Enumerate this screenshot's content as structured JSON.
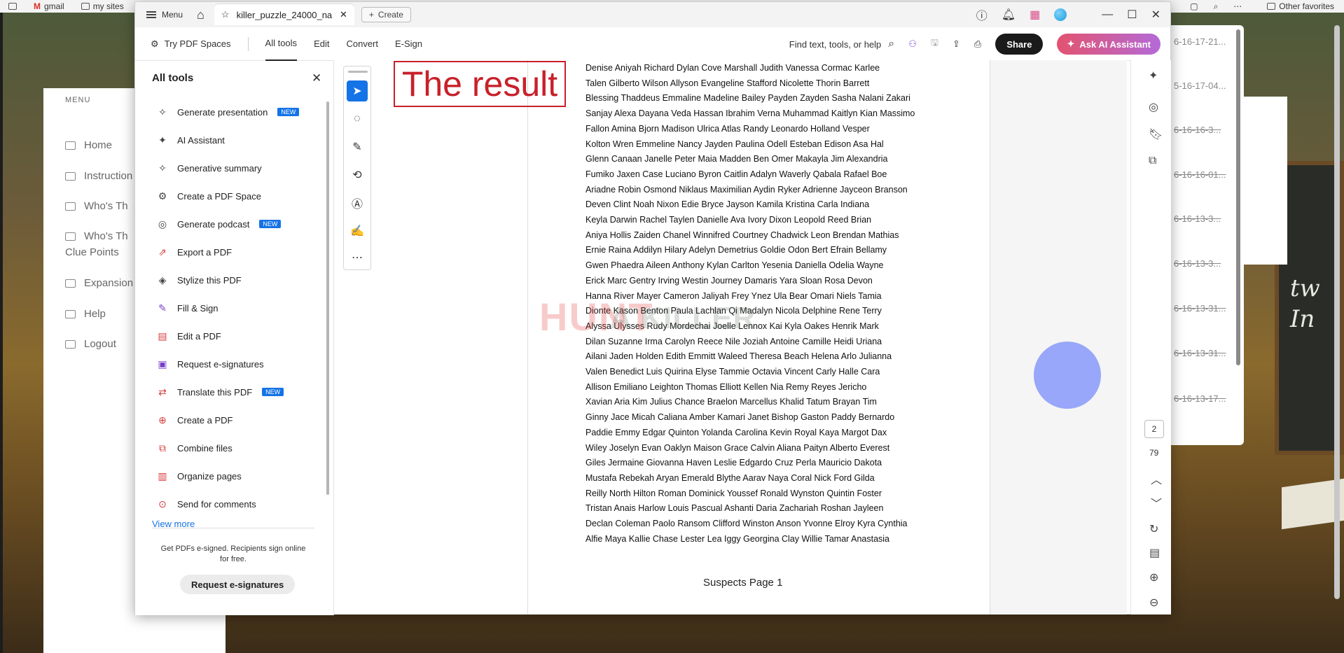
{
  "browser": {
    "bookmarks": [
      "gmail",
      "my sites"
    ],
    "other_favorites": "Other favorites"
  },
  "site": {
    "menu_title": "MENU",
    "nav": [
      "Home",
      "Instruction",
      "Who's Th",
      "Who's Th",
      "Clue Points",
      "Expansion",
      "Help",
      "Logout"
    ]
  },
  "side_window": {
    "entries": [
      "6-16-17-21...",
      "5-16-17-04...",
      "6-16-16-3...",
      "6-16-16-01...",
      "6-16-13-3...",
      "6-16-13-3...",
      "6-16-13-31...",
      "6-16-13-31...",
      "6-16-13-17..."
    ]
  },
  "blackboard": {
    "text": "tw\nIn"
  },
  "app": {
    "menu_label": "Menu",
    "tab_title": "killer_puzzle_24000_na...",
    "create_label": "Create",
    "toolbar": {
      "try_spaces": "Try PDF Spaces",
      "tabs": [
        "All tools",
        "Edit",
        "Convert",
        "E-Sign"
      ],
      "find": "Find text, tools, or help",
      "share": "Share",
      "ai": "Ask AI Assistant"
    },
    "tools_panel": {
      "title": "All tools",
      "items": [
        {
          "label": "Generate presentation",
          "badge": "NEW",
          "icon": "sparkle-icon"
        },
        {
          "label": "AI Assistant",
          "badge": "",
          "icon": "ai-chat-icon"
        },
        {
          "label": "Generative summary",
          "badge": "",
          "icon": "summary-icon"
        },
        {
          "label": "Create a PDF Space",
          "badge": "",
          "icon": "space-icon"
        },
        {
          "label": "Generate podcast",
          "badge": "NEW",
          "icon": "podcast-icon"
        },
        {
          "label": "Export a PDF",
          "badge": "",
          "icon": "export-icon"
        },
        {
          "label": "Stylize this PDF",
          "badge": "",
          "icon": "stylize-icon"
        },
        {
          "label": "Fill & Sign",
          "badge": "",
          "icon": "sign-icon"
        },
        {
          "label": "Edit a PDF",
          "badge": "",
          "icon": "edit-icon"
        },
        {
          "label": "Request e-signatures",
          "badge": "",
          "icon": "request-sign-icon"
        },
        {
          "label": "Translate this PDF",
          "badge": "NEW",
          "icon": "translate-icon"
        },
        {
          "label": "Create a PDF",
          "badge": "",
          "icon": "create-pdf-icon"
        },
        {
          "label": "Combine files",
          "badge": "",
          "icon": "combine-icon"
        },
        {
          "label": "Organize pages",
          "badge": "",
          "icon": "organize-icon"
        },
        {
          "label": "Send for comments",
          "badge": "",
          "icon": "comment-icon"
        }
      ],
      "view_more": "View more",
      "promo": "Get PDFs e-signed. Recipients sign online for free.",
      "promo_button": "Request e-signatures"
    },
    "document": {
      "result_text": "The result",
      "watermark_a": "HUNT",
      "watermark_b": "A KILLER",
      "names": [
        "Denise Aniyah Richard Dylan Cove Marshall Judith Vanessa Cormac Karlee",
        "Talen Gilberto Wilson Allyson Evangeline Stafford Nicolette Thorin Barrett",
        "Blessing Thaddeus Emmaline Madeline Bailey Payden Zayden Sasha Nalani Zakari",
        "Sanjay Alexa Dayana Veda Hassan Ibrahim Verna Muhammad Kaitlyn Kian Massimo",
        "Fallon Amina Bjorn Madison Ulrica Atlas Randy Leonardo Holland Vesper",
        "Kolton Wren Emmeline Nancy Jayden Paulina Odell Esteban Edison Asa Hal",
        "Glenn Canaan Janelle Peter Maia Madden Ben Omer Makayla Jim Alexandria",
        "Fumiko Jaxen Case Luciano Byron Caitlin Adalyn Waverly Qabala Rafael Boe",
        "Ariadne Robin Osmond Niklaus Maximilian Aydin Ryker Adrienne Jayceon Branson",
        "Deven Clint Noah Nixon Edie Bryce Jayson Kamila Kristina Carla Indiana",
        "Keyla Darwin Rachel Taylen Danielle Ava Ivory Dixon Leopold Reed Brian",
        "Aniya Hollis Zaiden Chanel Winnifred Courtney Chadwick Leon Brendan Mathias",
        "Ernie Raina Addilyn Hilary Adelyn Demetrius Goldie Odon Bert Efrain Bellamy",
        "Gwen Phaedra Aileen Anthony Kylan Carlton Yesenia Daniella Odelia Wayne",
        "Erick Marc Gentry Irving Westin Journey Damaris Yara Sloan Rosa Devon",
        "Hanna River Mayer Cameron Jaliyah Frey Ynez Ula Bear Omari Niels Tamia",
        "Dionte Kason Benton Paula Lachlan Qi Madalyn Nicola Delphine Rene Terry",
        "Alyssa Ulysses Rudy Mordechai Joelle Lennox Kai Kyla Oakes Henrik Mark",
        "Dilan Suzanne Irma Carolyn Reece Nile Joziah Antoine Camille Heidi Uriana",
        "Ailani Jaden Holden Edith Emmitt Waleed Theresa Beach Helena Arlo Julianna",
        "Valen Benedict Luis Quirina Elyse Tammie Octavia Vincent Carly Halle Cara",
        "Allison Emiliano Leighton Thomas Elliott Kellen Nia Remy Reyes Jericho",
        "Xavian Aria Kim Julius Chance Braelon Marcellus Khalid Tatum Brayan Tim",
        "Ginny Jace Micah Caliana Amber Kamari Janet Bishop Gaston Paddy Bernardo",
        "Paddie Emmy Edgar Quinton Yolanda Carolina Kevin Royal Kaya Margot Dax",
        "Wiley Joselyn Evan Oaklyn Maison Grace Calvin Aliana Paityn Alberto Everest",
        "Giles Jermaine Giovanna Haven Leslie Edgardo Cruz Perla Mauricio Dakota",
        "Mustafa Rebekah Aryan Emerald Blythe Aarav Naya Coral Nick Ford Gilda",
        "Reilly North Hilton Roman Dominick Youssef Ronald Wynston Quintin Foster",
        "Tristan Anais Harlow Louis Pascual Ashanti Daria Zachariah Roshan Jayleen",
        "Declan Coleman Paolo Ransom Clifford Winston Anson Yvonne Elroy Kyra Cynthia",
        "Alfie Maya Kallie Chase Lester Lea Iggy Georgina Clay Willie Tamar Anastasia"
      ],
      "footer": "Suspects Page 1",
      "current_page": "2",
      "total_pages": "79"
    }
  }
}
